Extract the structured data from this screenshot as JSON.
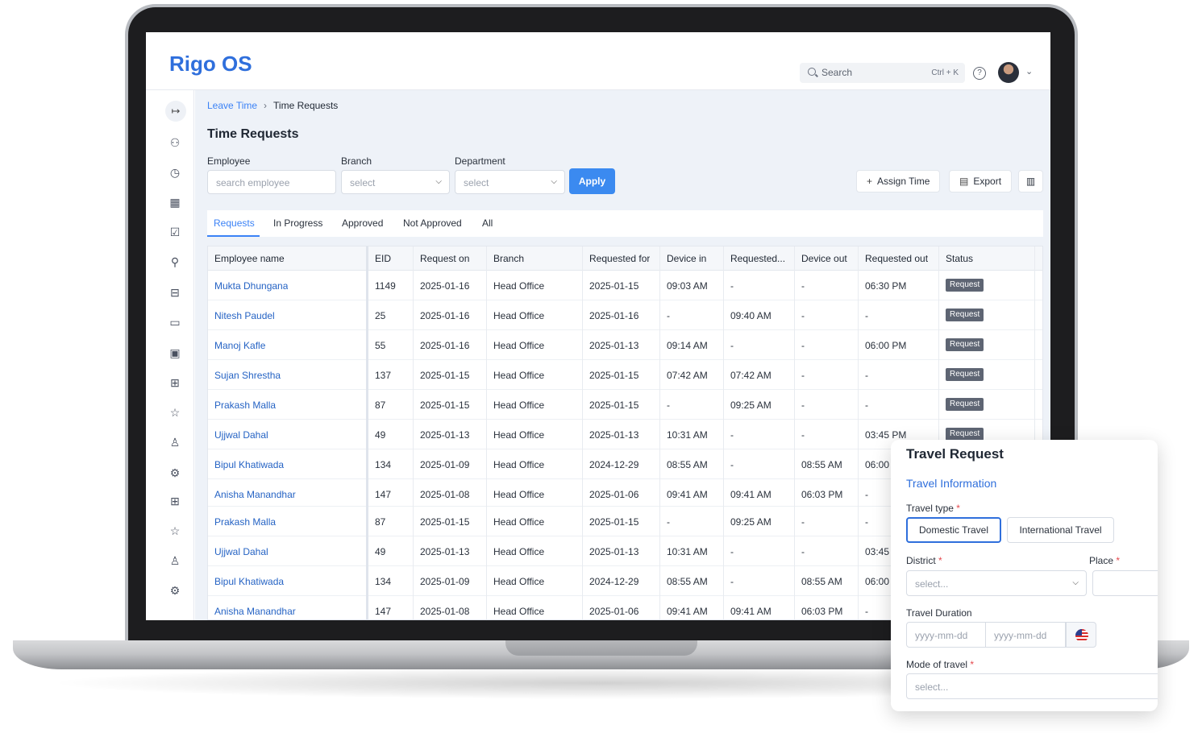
{
  "app": {
    "logo": "Rigo OS"
  },
  "topbar": {
    "search_placeholder": "Search",
    "search_shortcut": "Ctrl + K",
    "help_icon": "?",
    "chevron": "⌄"
  },
  "breadcrumb": {
    "parent": "Leave Time",
    "separator": "›",
    "current": "Time Requests"
  },
  "page": {
    "title": "Time Requests"
  },
  "filters": {
    "employee_label": "Employee",
    "employee_placeholder": "search employee",
    "branch_label": "Branch",
    "branch_placeholder": "select",
    "department_label": "Department",
    "department_placeholder": "select",
    "apply_label": "Apply"
  },
  "toolbar": {
    "assign_label": "Assign Time",
    "export_label": "Export"
  },
  "tabs": [
    "Requests",
    "In Progress",
    "Approved",
    "Not Approved",
    "All"
  ],
  "table": {
    "columns": [
      "Employee name",
      "EID",
      "Request on",
      "Branch",
      "Requested for",
      "Device in",
      "Requested...",
      "Device out",
      "Requested out",
      "Status"
    ],
    "rows": [
      [
        "Mukta Dhungana",
        "1149",
        "2025-01-16",
        "Head Office",
        "2025-01-15",
        "09:03 AM",
        "-",
        "-",
        "06:30 PM",
        "Request"
      ],
      [
        "Nitesh Paudel",
        "25",
        "2025-01-16",
        "Head Office",
        "2025-01-16",
        "-",
        "09:40 AM",
        "-",
        "-",
        "Request"
      ],
      [
        "Manoj Kafle",
        "55",
        "2025-01-16",
        "Head Office",
        "2025-01-13",
        "09:14 AM",
        "-",
        "-",
        "06:00 PM",
        "Request"
      ],
      [
        "Sujan Shrestha",
        "137",
        "2025-01-15",
        "Head Office",
        "2025-01-15",
        "07:42 AM",
        "07:42 AM",
        "-",
        "-",
        "Request"
      ],
      [
        "Prakash Malla",
        "87",
        "2025-01-15",
        "Head Office",
        "2025-01-15",
        "-",
        "09:25 AM",
        "-",
        "-",
        "Request"
      ],
      [
        "Ujjwal Dahal",
        "49",
        "2025-01-13",
        "Head Office",
        "2025-01-13",
        "10:31 AM",
        "-",
        "-",
        "03:45 PM",
        "Request"
      ],
      [
        "Bipul Khatiwada",
        "134",
        "2025-01-09",
        "Head Office",
        "2024-12-29",
        "08:55 AM",
        "-",
        "08:55 AM",
        "06:00",
        ""
      ],
      [
        "Anisha Manandhar",
        "147",
        "2025-01-08",
        "Head Office",
        "2025-01-06",
        "09:41 AM",
        "09:41 AM",
        "06:03 PM",
        "-",
        ""
      ],
      [
        "Prakash Malla",
        "87",
        "2025-01-15",
        "Head Office",
        "2025-01-15",
        "-",
        "09:25 AM",
        "-",
        "-",
        ""
      ],
      [
        "Ujjwal Dahal",
        "49",
        "2025-01-13",
        "Head Office",
        "2025-01-13",
        "10:31 AM",
        "-",
        "-",
        "03:45",
        ""
      ],
      [
        "Bipul Khatiwada",
        "134",
        "2025-01-09",
        "Head Office",
        "2024-12-29",
        "08:55 AM",
        "-",
        "08:55 AM",
        "06:00",
        ""
      ],
      [
        "Anisha Manandhar",
        "147",
        "2025-01-08",
        "Head Office",
        "2025-01-06",
        "09:41 AM",
        "09:41 AM",
        "06:03 PM",
        "-",
        ""
      ]
    ]
  },
  "travel": {
    "title": "Travel Request",
    "section": "Travel Information",
    "type_label": "Travel type",
    "type_options": [
      "Domestic Travel",
      "International Travel"
    ],
    "type_selected": "Domestic Travel",
    "district_label": "District",
    "district_placeholder": "select...",
    "place_label": "Place",
    "duration_label": "Travel Duration",
    "date_placeholder": "yyyy-mm-dd",
    "mode_label": "Mode of travel",
    "mode_placeholder": "select...",
    "required_mark": "*"
  },
  "icons": {
    "sidebar": [
      "users-icon",
      "calendar-clock-icon",
      "grid-icon",
      "checklist-icon",
      "user-search-icon",
      "briefcase-icon",
      "id-card-icon",
      "calendar-icon",
      "gift-icon",
      "star-icon",
      "award-icon",
      "settings-icon",
      "gift-icon",
      "star-icon",
      "award-icon",
      "settings-icon"
    ]
  },
  "colors": {
    "brand": "#2f6fdc",
    "apply": "#3b8af0",
    "badge": "#5e6573",
    "required": "#e5484d"
  }
}
